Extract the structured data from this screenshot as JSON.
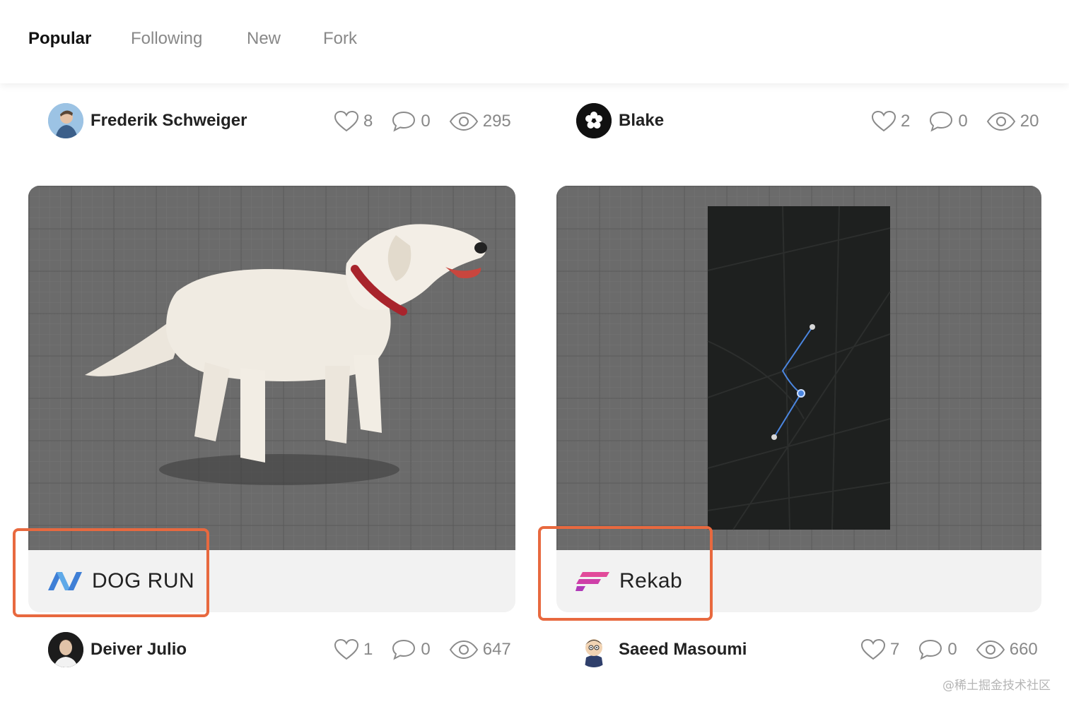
{
  "tabs": [
    {
      "label": "Popular",
      "active": true
    },
    {
      "label": "Following",
      "active": false
    },
    {
      "label": "New",
      "active": false
    },
    {
      "label": "Fork",
      "active": false
    }
  ],
  "top_row": [
    {
      "author": "Frederik Schweiger",
      "likes": "8",
      "comments": "0",
      "views": "295"
    },
    {
      "author": "Blake",
      "likes": "2",
      "comments": "0",
      "views": "20"
    }
  ],
  "cards": [
    {
      "project": "DOG RUN",
      "logo_icon": "dog-run-logo-icon",
      "logo_color": "#3f7fd6"
    },
    {
      "project": "Rekab",
      "logo_icon": "rekab-logo-icon",
      "logo_color": "#e24a9a"
    }
  ],
  "bottom_row": [
    {
      "author": "Deiver Julio",
      "likes": "1",
      "comments": "0",
      "views": "647"
    },
    {
      "author": "Saeed Masoumi",
      "likes": "7",
      "comments": "0",
      "views": "660"
    }
  ],
  "highlight_color": "#e8693f",
  "watermark": "@稀土掘金技术社区"
}
